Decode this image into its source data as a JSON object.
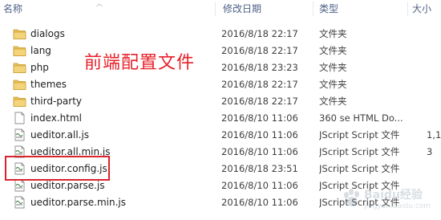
{
  "columns": {
    "name": "名称",
    "date": "修改日期",
    "type": "类型",
    "size": "大小"
  },
  "files": [
    {
      "name": "dialogs",
      "date": "2016/8/18 22:17",
      "type": "文件夹",
      "size": "",
      "icon": "folder-icon"
    },
    {
      "name": "lang",
      "date": "2016/8/18 22:17",
      "type": "文件夹",
      "size": "",
      "icon": "folder-icon"
    },
    {
      "name": "php",
      "date": "2016/8/18 23:23",
      "type": "文件夹",
      "size": "",
      "icon": "folder-icon"
    },
    {
      "name": "themes",
      "date": "2016/8/18 22:17",
      "type": "文件夹",
      "size": "",
      "icon": "folder-icon"
    },
    {
      "name": "third-party",
      "date": "2016/8/18 22:17",
      "type": "文件夹",
      "size": "",
      "icon": "folder-icon"
    },
    {
      "name": "index.html",
      "date": "2016/8/10 11:06",
      "type": "360 se HTML Do...",
      "size": "",
      "icon": "html-file-icon"
    },
    {
      "name": "ueditor.all.js",
      "date": "2016/8/10 11:06",
      "type": "JScript Script 文件",
      "size": "1,1",
      "icon": "script-file-icon"
    },
    {
      "name": "ueditor.all.min.js",
      "date": "2016/8/10 11:06",
      "type": "JScript Script 文件",
      "size": "3",
      "icon": "script-file-icon"
    },
    {
      "name": "ueditor.config.js",
      "date": "2016/8/18 23:51",
      "type": "JScript Script 文件",
      "size": "",
      "icon": "script-file-icon"
    },
    {
      "name": "ueditor.parse.js",
      "date": "2016/8/10 11:06",
      "type": "JScript Script 文件",
      "size": "",
      "icon": "script-file-icon"
    },
    {
      "name": "ueditor.parse.min.js",
      "date": "2016/8/10 11:06",
      "type": "JScript Script 文件",
      "size": "",
      "icon": "script-file-icon"
    }
  ],
  "annotation": "前端配置文件",
  "watermark": {
    "text": "Baidu经验",
    "sub": "jingyan.baidu.com"
  },
  "colors": {
    "annotation": "#e8202a",
    "highlight_border": "#d9242c",
    "header_text": "#4d6185",
    "folder": "#e8c15a"
  }
}
